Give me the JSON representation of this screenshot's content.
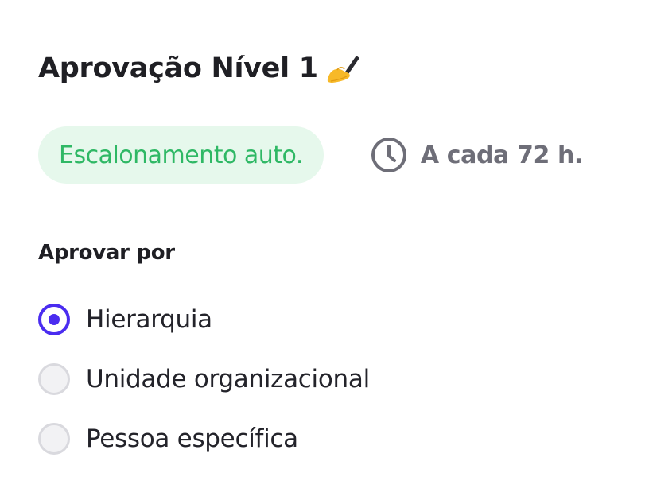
{
  "header": {
    "title": "Aprovação Nível 1",
    "title_emoji": "writing-hand-icon"
  },
  "badge": {
    "label": "Escalonamento auto.",
    "bg_color": "#e6f8ec",
    "text_color": "#2fb865"
  },
  "schedule": {
    "icon": "clock-icon",
    "label": "A cada 72 h."
  },
  "approval": {
    "section_label": "Aprovar por",
    "accent_color": "#4a2cf0",
    "options": [
      {
        "label": "Hierarquia",
        "selected": true
      },
      {
        "label": "Unidade organizacional",
        "selected": false
      },
      {
        "label": "Pessoa específica",
        "selected": false
      }
    ]
  }
}
